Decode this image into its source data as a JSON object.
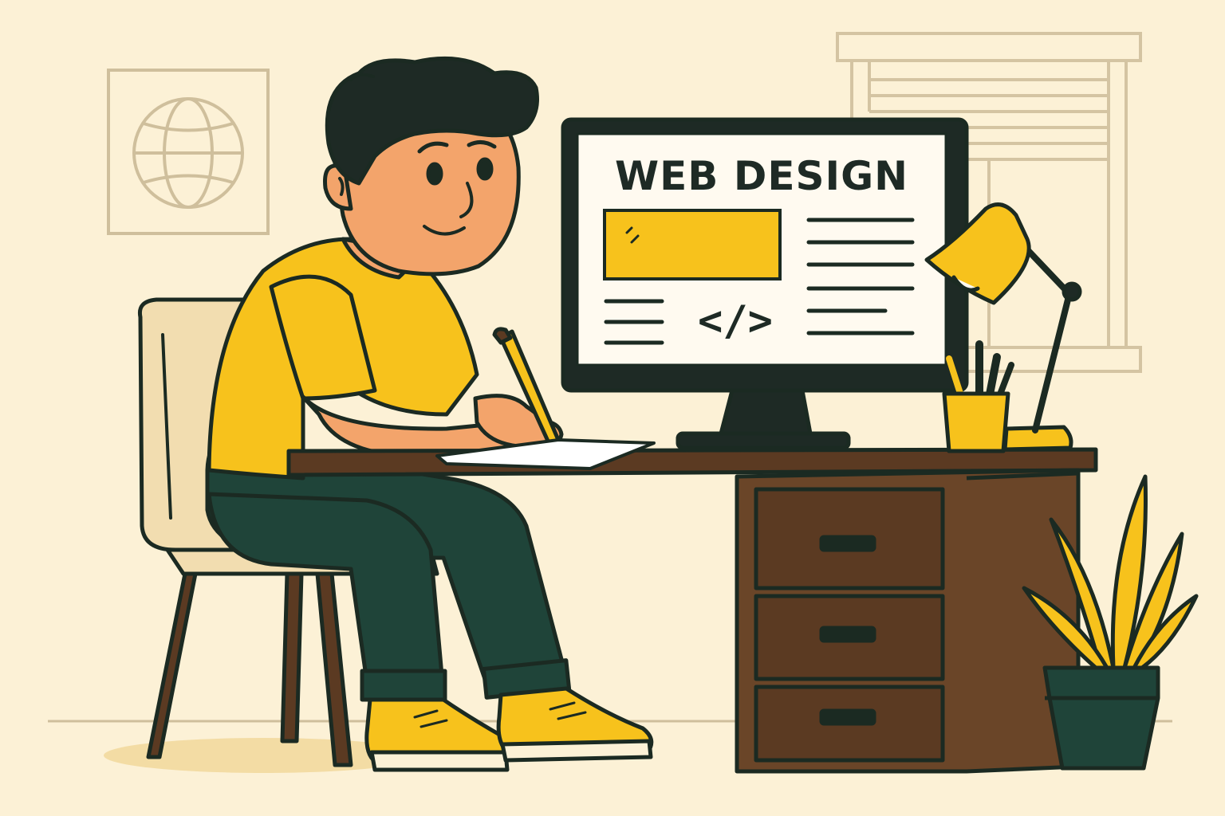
{
  "screen": {
    "title": "WEB DESIGN",
    "code_symbol": "</>"
  },
  "icons": {
    "wall_art": "globe-icon",
    "screen_symbol": "code-icon"
  },
  "colors": {
    "background": "#fcf1d6",
    "outline": "#1b2a22",
    "accent_yellow": "#f7c21c",
    "skin": "#f3a46b",
    "desk_wood": "#5b3a22",
    "pants": "#1f4439",
    "hair": "#1e2a25",
    "chair": "#f2ddb0",
    "line_art": "#cfbf9c"
  }
}
